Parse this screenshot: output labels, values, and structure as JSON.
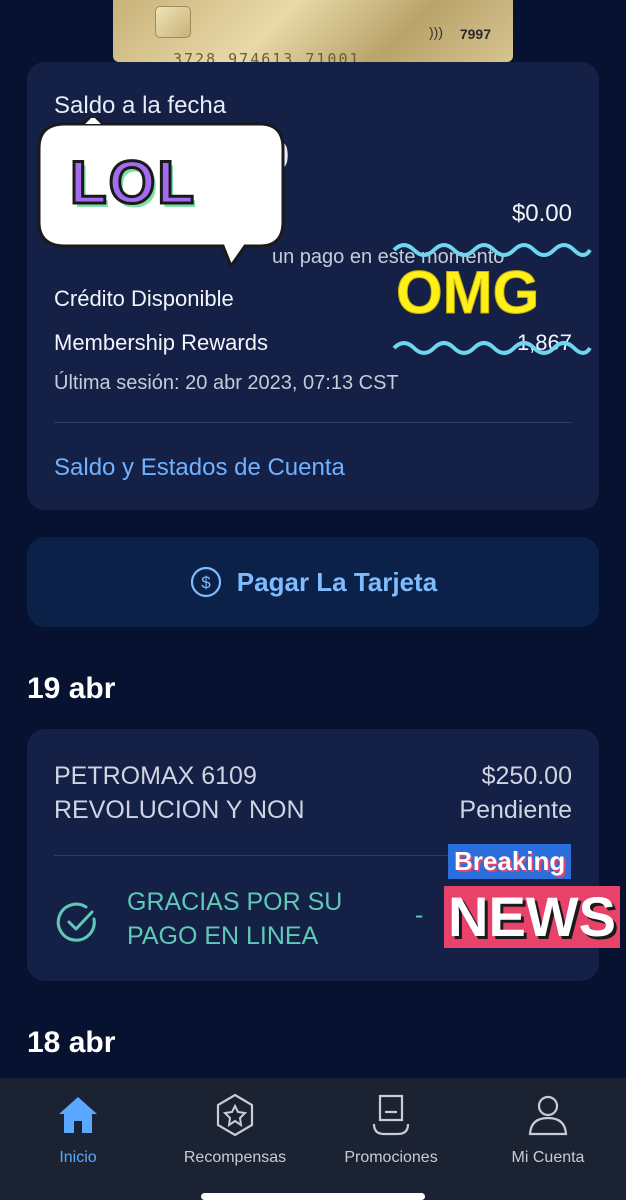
{
  "card": {
    "last4": "7997",
    "embossed": "3728 974613 71001"
  },
  "balance": {
    "title": "Saldo a la fecha",
    "amount_partial": "0",
    "pending_value": "$0.00",
    "note_partial": "un pago en este momento",
    "available_label": "Crédito Disponible",
    "rewards_label": "Membership Rewards",
    "rewards_partial": "1,867",
    "last_session": "Última sesión: 20 abr 2023, 07:13 CST",
    "statements_link": "Saldo y Estados de Cuenta"
  },
  "pay_button": {
    "label": "Pagar La Tarjeta",
    "icon": "dollar-circle-icon"
  },
  "sections": [
    {
      "date": "19 abr"
    },
    {
      "date": "18 abr"
    }
  ],
  "transactions": [
    {
      "merchant_line1": "PETROMAX 6109",
      "merchant_line2": "REVOLUCION Y NON",
      "amount": "$250.00",
      "status": "Pendiente"
    },
    {
      "desc_line1": "GRACIAS POR SU",
      "desc_line2": "PAGO EN LINEA",
      "amount_partial": "-",
      "icon": "check-circle-icon"
    }
  ],
  "stickers": {
    "lol": "LOL",
    "omg": "OMG",
    "breaking": "Breaking",
    "news": "NEWS"
  },
  "nav": [
    {
      "label": "Inicio",
      "icon": "home-icon",
      "active": true
    },
    {
      "label": "Recompensas",
      "icon": "star-badge-icon"
    },
    {
      "label": "Promociones",
      "icon": "promo-tag-icon"
    },
    {
      "label": "Mi Cuenta",
      "icon": "user-icon"
    }
  ],
  "colors": {
    "background": "#071230",
    "panel": "#142046",
    "link": "#6fb2ff",
    "accent_green": "#5ec9b4",
    "nav_active": "#5aa8ff"
  }
}
